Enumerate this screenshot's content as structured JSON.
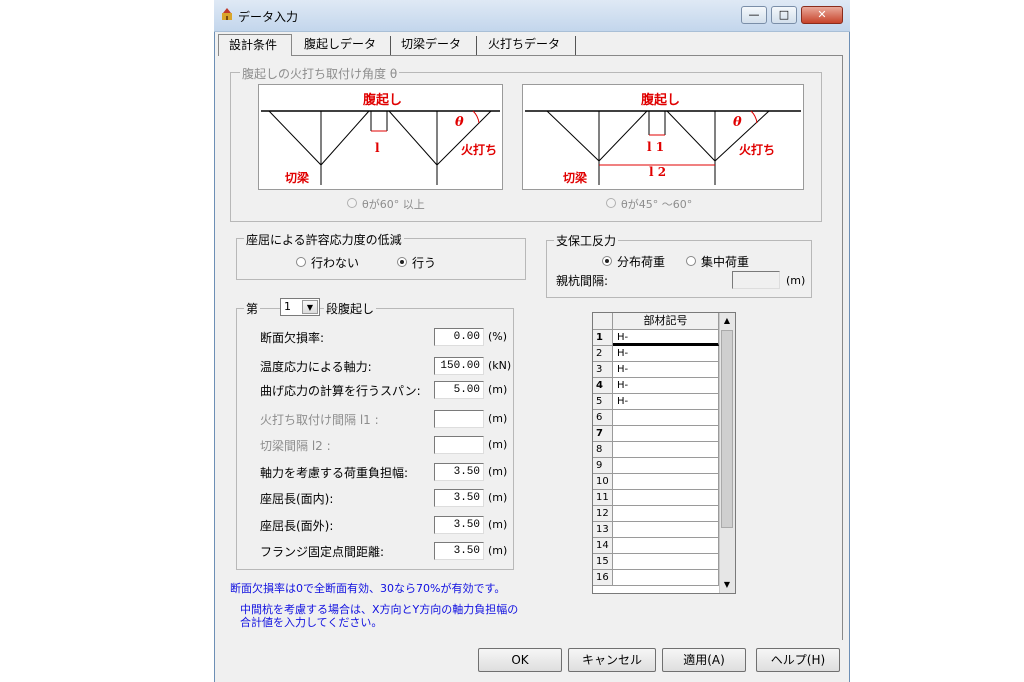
{
  "window": {
    "title": "データ入力",
    "controls": {
      "minimize": "—",
      "maximize": "□",
      "close": "✕"
    }
  },
  "tabs": [
    {
      "label": "設計条件",
      "active": true
    },
    {
      "label": "腹起しデータ",
      "active": false
    },
    {
      "label": "切梁データ",
      "active": false
    },
    {
      "label": "火打ちデータ",
      "active": false
    }
  ],
  "angle_group": {
    "legend": "腹起しの火打ち取付け角度 θ",
    "diagram1": {
      "haraokoshi": "腹起し",
      "theta": "θ",
      "hiuchi": "火打ち",
      "kiribari": "切梁",
      "l1": "l"
    },
    "diagram2": {
      "haraokoshi": "腹起し",
      "theta": "θ",
      "hiuchi": "火打ち",
      "kiribari": "切梁",
      "l1": "l 1",
      "l2": "l 2"
    },
    "option1": "θが60° 以上",
    "option2": "θが45° ～60°"
  },
  "buckling_group": {
    "legend": "座屈による許容応力度の低減",
    "option_no": "行わない",
    "option_yes": "行う",
    "selected": "行う"
  },
  "support_group": {
    "legend": "支保工反力",
    "option_distributed": "分布荷重",
    "option_concentrated": "集中荷重",
    "selected": "分布荷重",
    "pile_spacing_label": "親杭間隔:",
    "pile_spacing_value": "",
    "pile_spacing_unit": "(m)"
  },
  "stage_group": {
    "prefix": "第",
    "stage_value": "1",
    "suffix": "段腹起し",
    "fields": [
      {
        "label": "断面欠損率:",
        "value": "0.00",
        "unit": "(%)",
        "enabled": true
      },
      {
        "label": "温度応力による軸力:",
        "value": "150.00",
        "unit": "(kN)",
        "enabled": true
      },
      {
        "label": "曲げ応力の計算を行うスパン:",
        "value": "5.00",
        "unit": "(m)",
        "enabled": true
      },
      {
        "label": "火打ち取付け間隔  l1 :",
        "value": "",
        "unit": "(m)",
        "enabled": false
      },
      {
        "label": "切梁間隔  l2 :",
        "value": "",
        "unit": "(m)",
        "enabled": false
      },
      {
        "label": "軸力を考慮する荷重負担幅:",
        "value": "3.50",
        "unit": "(m)",
        "enabled": true
      },
      {
        "label": "座屈長(面内):",
        "value": "3.50",
        "unit": "(m)",
        "enabled": true
      },
      {
        "label": "座屈長(面外):",
        "value": "3.50",
        "unit": "(m)",
        "enabled": true
      },
      {
        "label": "フランジ固定点間距離:",
        "value": "3.50",
        "unit": "(m)",
        "enabled": true
      }
    ]
  },
  "member_grid": {
    "header": "部材記号",
    "rows": [
      {
        "n": "1",
        "v": "H-"
      },
      {
        "n": "2",
        "v": "H-"
      },
      {
        "n": "3",
        "v": "H-"
      },
      {
        "n": "4",
        "v": "H-"
      },
      {
        "n": "5",
        "v": "H-"
      },
      {
        "n": "6",
        "v": ""
      },
      {
        "n": "7",
        "v": ""
      },
      {
        "n": "8",
        "v": ""
      },
      {
        "n": "9",
        "v": ""
      },
      {
        "n": "10",
        "v": ""
      },
      {
        "n": "11",
        "v": ""
      },
      {
        "n": "12",
        "v": ""
      },
      {
        "n": "13",
        "v": ""
      },
      {
        "n": "14",
        "v": ""
      },
      {
        "n": "15",
        "v": ""
      },
      {
        "n": "16",
        "v": ""
      }
    ]
  },
  "notes": {
    "line1": "断面欠損率は0で全断面有効、30なら70%が有効です。",
    "line2": "中間杭を考慮する場合は、X方向とY方向の軸力負担幅の",
    "line3": "合計値を入力してください。"
  },
  "buttons": {
    "ok": "OK",
    "cancel": "キャンセル",
    "apply": "適用(A)",
    "help": "ヘルプ(H)"
  },
  "colors": {
    "diagram_label": "#e00000",
    "note_text": "#1010e0",
    "disabled_text": "#8d8d8d"
  }
}
